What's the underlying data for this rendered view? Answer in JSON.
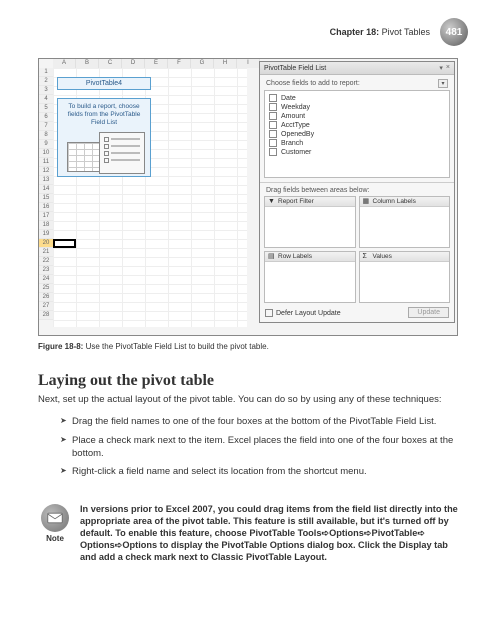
{
  "header": {
    "chapter_prefix": "Chapter 18:",
    "chapter_title": "Pivot Tables",
    "page_number": "481"
  },
  "figure": {
    "columns": [
      "A",
      "B",
      "C",
      "D",
      "E",
      "F",
      "G",
      "H",
      "I"
    ],
    "rows": [
      "1",
      "2",
      "3",
      "4",
      "5",
      "6",
      "7",
      "8",
      "9",
      "10",
      "11",
      "12",
      "13",
      "14",
      "15",
      "16",
      "17",
      "18",
      "19",
      "20",
      "21",
      "22",
      "23",
      "24",
      "25",
      "26",
      "27",
      "28"
    ],
    "selected_row": "20",
    "pt_name": "PivotTable4",
    "pt_help_l1": "To build a report, choose",
    "pt_help_l2": "fields from the PivotTable",
    "pt_help_l3": "Field List",
    "field_list": {
      "title": "PivotTable Field List",
      "subtitle": "Choose fields to add to report:",
      "fields": [
        "Date",
        "Weekday",
        "Amount",
        "AcctType",
        "OpenedBy",
        "Branch",
        "Customer"
      ],
      "drag_label": "Drag fields between areas below:",
      "zones": {
        "report_filter": "Report Filter",
        "column_labels": "Column Labels",
        "row_labels": "Row Labels",
        "values": "Values"
      },
      "defer_label": "Defer Layout Update",
      "update_btn": "Update"
    },
    "caption_prefix": "Figure 18-8:",
    "caption_text": "Use the PivotTable Field List to build the pivot table."
  },
  "section": {
    "heading": "Laying out the pivot table",
    "intro": "Next, set up the actual layout of the pivot table. You can do so by using any of these techniques:",
    "bullets": [
      "Drag the field names to one of the four boxes at the bottom of the PivotTable Field List.",
      "Place a check mark next to the item. Excel places the field into one of the four boxes at the bottom.",
      "Right-click a field name and select its location from the shortcut menu."
    ]
  },
  "note": {
    "label": "Note",
    "text": "In versions prior to Excel 2007, you could drag items from the field list directly into the appropriate area of the pivot table. This feature is still available, but it's turned off by default. To enable this feature, choose PivotTable Tools➪Options➪PivotTable➪ Options➪Options to display the PivotTable Options dialog box. Click the Display tab and add a check mark next to Classic PivotTable Layout."
  }
}
